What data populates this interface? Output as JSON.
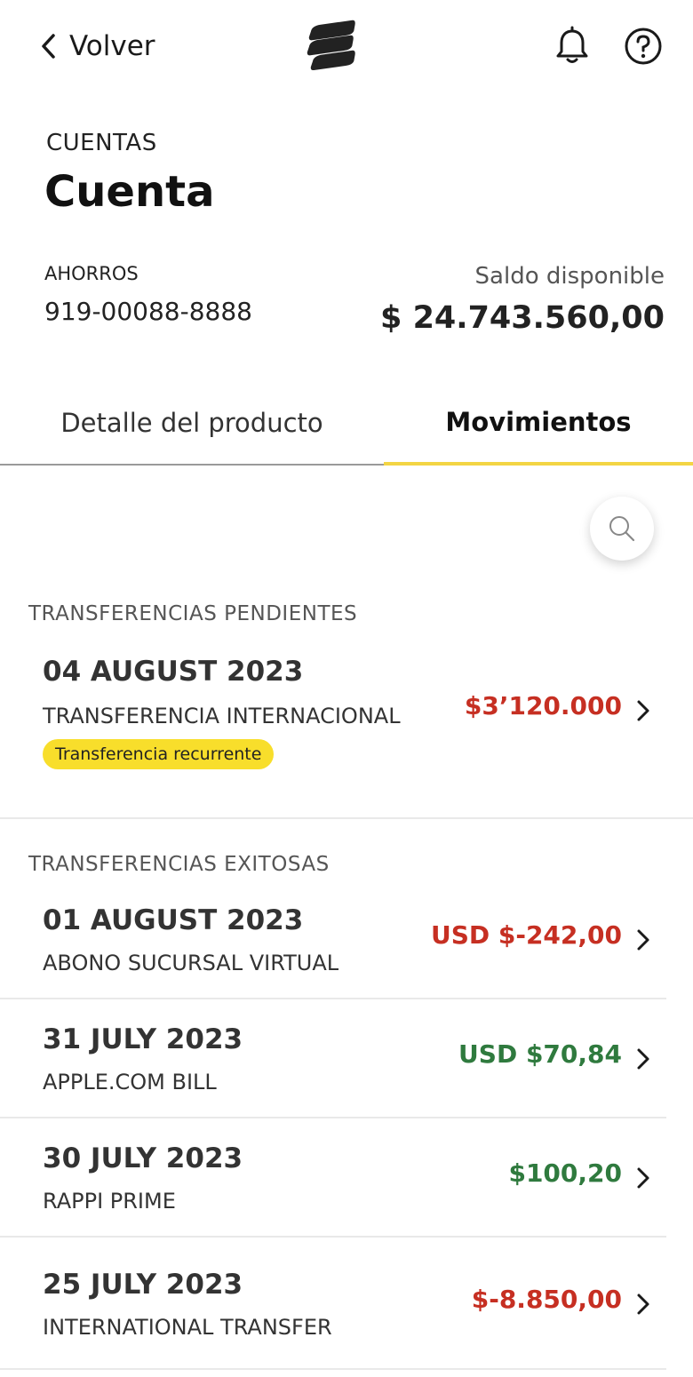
{
  "header": {
    "back_label": "Volver"
  },
  "title": {
    "kicker": "CUENTAS",
    "main": "Cuenta"
  },
  "account": {
    "type": "AHORROS",
    "number": "919-00088-8888",
    "balance_label": "Saldo disponible",
    "balance_value": "$ 24.743.560,00"
  },
  "tabs": [
    {
      "label": "Detalle del producto",
      "active": false
    },
    {
      "label": "Movimientos",
      "active": true
    }
  ],
  "pending": {
    "title": "TRANSFERENCIAS PENDIENTES",
    "items": [
      {
        "date": "04 AUGUST 2023",
        "description": "TRANSFERENCIA INTERNACIONAL",
        "amount": "$3’120.000",
        "status": "negative",
        "badge": "Transferencia recurrente"
      }
    ]
  },
  "successful": {
    "title": "TRANSFERENCIAS EXITOSAS",
    "items": [
      {
        "date": "01 AUGUST 2023",
        "description": "ABONO SUCURSAL VIRTUAL",
        "amount": "USD $-242,00",
        "status": "negative"
      },
      {
        "date": "31 JULY 2023",
        "description": "APPLE.COM BILL",
        "amount": "USD $70,84",
        "status": "positive"
      },
      {
        "date": "30 JULY 2023",
        "description": "RAPPI PRIME",
        "amount": "$100,20",
        "status": "positive"
      },
      {
        "date": "25 JULY 2023",
        "description": "INTERNATIONAL TRANSFER",
        "amount": "$-8.850,00",
        "status": "negative"
      }
    ]
  },
  "colors": {
    "accent": "#f3d544",
    "badge": "#f8de2b",
    "negative": "#c62f22",
    "positive": "#2f7a3e"
  },
  "icons": [
    "chevron-left-icon",
    "brand-logo",
    "bell-icon",
    "help-icon",
    "search-icon",
    "chevron-right-icon"
  ]
}
